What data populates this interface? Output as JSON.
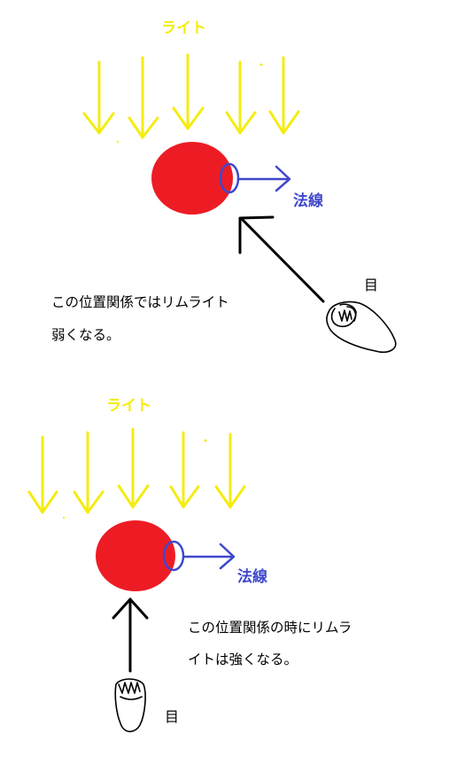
{
  "colors": {
    "light": "#f5ec12",
    "sphere": "#ed1c24",
    "normal": "#3f48cc",
    "ink": "#000000"
  },
  "top": {
    "light_label": "ライト",
    "normal_label": "法線",
    "eye_label": "目",
    "caption_line1": "この位置関係ではリムライト",
    "caption_line2": "弱くなる。"
  },
  "bottom": {
    "light_label": "ライト",
    "normal_label": "法線",
    "eye_label": "目",
    "caption_line1": "この位置関係の時にリムラ",
    "caption_line2": "イトは強くなる。"
  }
}
